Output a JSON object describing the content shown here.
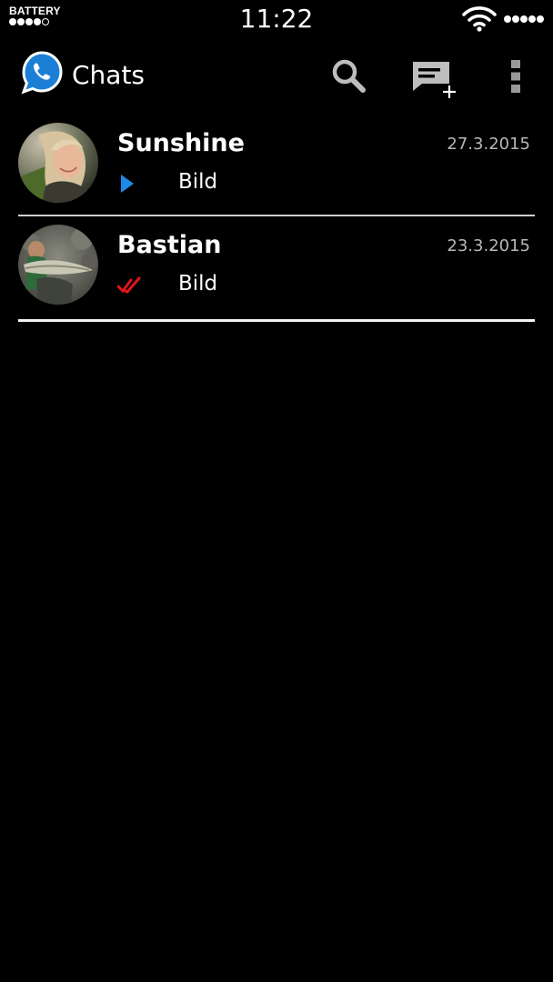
{
  "status_bar": {
    "battery_label": "BATTERY",
    "time": "11:22",
    "wifi_icon": "wifi-icon"
  },
  "app_bar": {
    "logo_icon": "whatsapp-logo-icon",
    "title": "Chats",
    "actions": [
      {
        "icon": "search-icon"
      },
      {
        "icon": "new-chat-icon"
      },
      {
        "icon": "overflow-menu-icon"
      }
    ]
  },
  "chats": [
    {
      "name": "Sunshine",
      "date": "27.3.2015",
      "preview": "Bild",
      "status_icon": "play-arrow-icon",
      "status_color": "#1e88e5"
    },
    {
      "name": "Bastian",
      "date": "23.3.2015",
      "preview": "Bild",
      "status_icon": "double-check-icon",
      "status_color": "#e0161b"
    }
  ],
  "colors": {
    "background": "#000000",
    "text": "#ffffff",
    "date": "#b7b7b7",
    "logo_blue": "#1b7fd6"
  }
}
